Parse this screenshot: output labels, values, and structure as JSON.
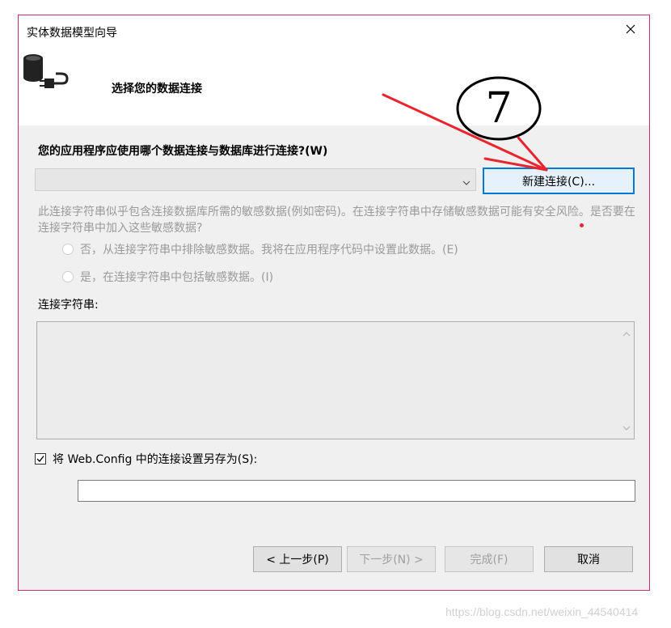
{
  "window": {
    "title": "实体数据模型向导",
    "close_glyph": "✕"
  },
  "header": {
    "title": "选择您的数据连接",
    "icon": "database-plug-icon"
  },
  "annotation": {
    "circle_number": "7",
    "color": "#e8252e"
  },
  "connection": {
    "prompt": "您的应用程序应使用哪个数据连接与数据库进行连接?(W)",
    "selected_value": "",
    "new_connection_label": "新建连接(C)..."
  },
  "sensitive": {
    "warning": "此连接字符串似乎包含连接数据库所需的敏感数据(例如密码)。在连接字符串中存储敏感数据可能有安全风险。是否要在连接字符串中加入这些敏感数据?",
    "exclude_label": "否，从连接字符串中排除敏感数据。我将在应用程序代码中设置此数据。(E)",
    "include_label": "是，在连接字符串中包括敏感数据。(I)"
  },
  "connection_string": {
    "label": "连接字符串:",
    "value": ""
  },
  "save": {
    "checked": true,
    "label": "将 Web.Config 中的连接设置另存为(S):",
    "value": ""
  },
  "buttons": {
    "prev": "< 上一步(P)",
    "next": "下一步(N) >",
    "finish": "完成(F)",
    "cancel": "取消"
  },
  "watermark": "https://blog.csdn.net/weixin_44540414",
  "colors": {
    "accent": "#0078d7",
    "window_border": "#d22b6e",
    "disabled_text": "#9a9a9a"
  }
}
